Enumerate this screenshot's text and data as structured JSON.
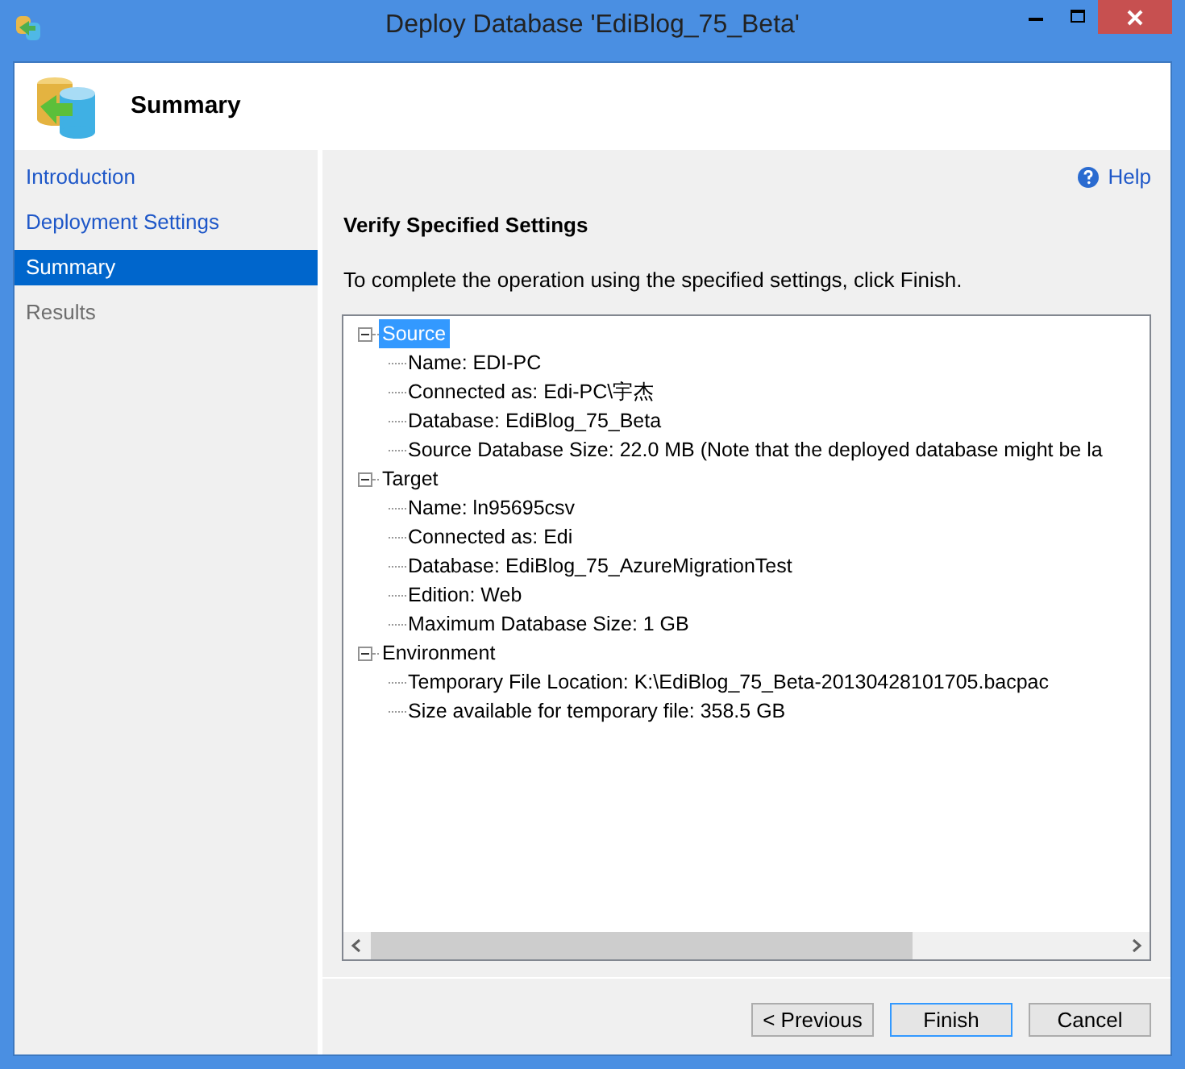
{
  "window": {
    "title": "Deploy Database 'EdiBlog_75_Beta'"
  },
  "header": {
    "title": "Summary"
  },
  "sidebar": {
    "items": [
      {
        "label": "Introduction",
        "selected": false,
        "disabled": false
      },
      {
        "label": "Deployment Settings",
        "selected": false,
        "disabled": false
      },
      {
        "label": "Summary",
        "selected": true,
        "disabled": false
      },
      {
        "label": "Results",
        "selected": false,
        "disabled": true
      }
    ]
  },
  "help": {
    "label": "Help"
  },
  "content": {
    "heading": "Verify Specified Settings",
    "description": "To complete the operation using the specified settings, click Finish."
  },
  "tree": [
    {
      "label": "Source",
      "expanded": true,
      "selected": true,
      "children": [
        {
          "label": "Name: EDI-PC"
        },
        {
          "label": "Connected as: Edi-PC\\宇杰"
        },
        {
          "label": "Database: EdiBlog_75_Beta"
        },
        {
          "label": "Source Database Size: 22.0 MB (Note that the deployed database might be la"
        }
      ]
    },
    {
      "label": "Target",
      "expanded": true,
      "selected": false,
      "children": [
        {
          "label": "Name: ln95695csv"
        },
        {
          "label": "Connected as: Edi"
        },
        {
          "label": "Database: EdiBlog_75_AzureMigrationTest"
        },
        {
          "label": "Edition: Web"
        },
        {
          "label": "Maximum Database Size: 1 GB"
        }
      ]
    },
    {
      "label": "Environment",
      "expanded": true,
      "selected": false,
      "children": [
        {
          "label": "Temporary File Location: K:\\EdiBlog_75_Beta-20130428101705.bacpac"
        },
        {
          "label": "Size available for temporary file: 358.5 GB"
        }
      ]
    }
  ],
  "buttons": [
    {
      "label": "< Previous",
      "default": false
    },
    {
      "label": "Finish",
      "default": true
    },
    {
      "label": "Cancel",
      "default": false
    }
  ]
}
